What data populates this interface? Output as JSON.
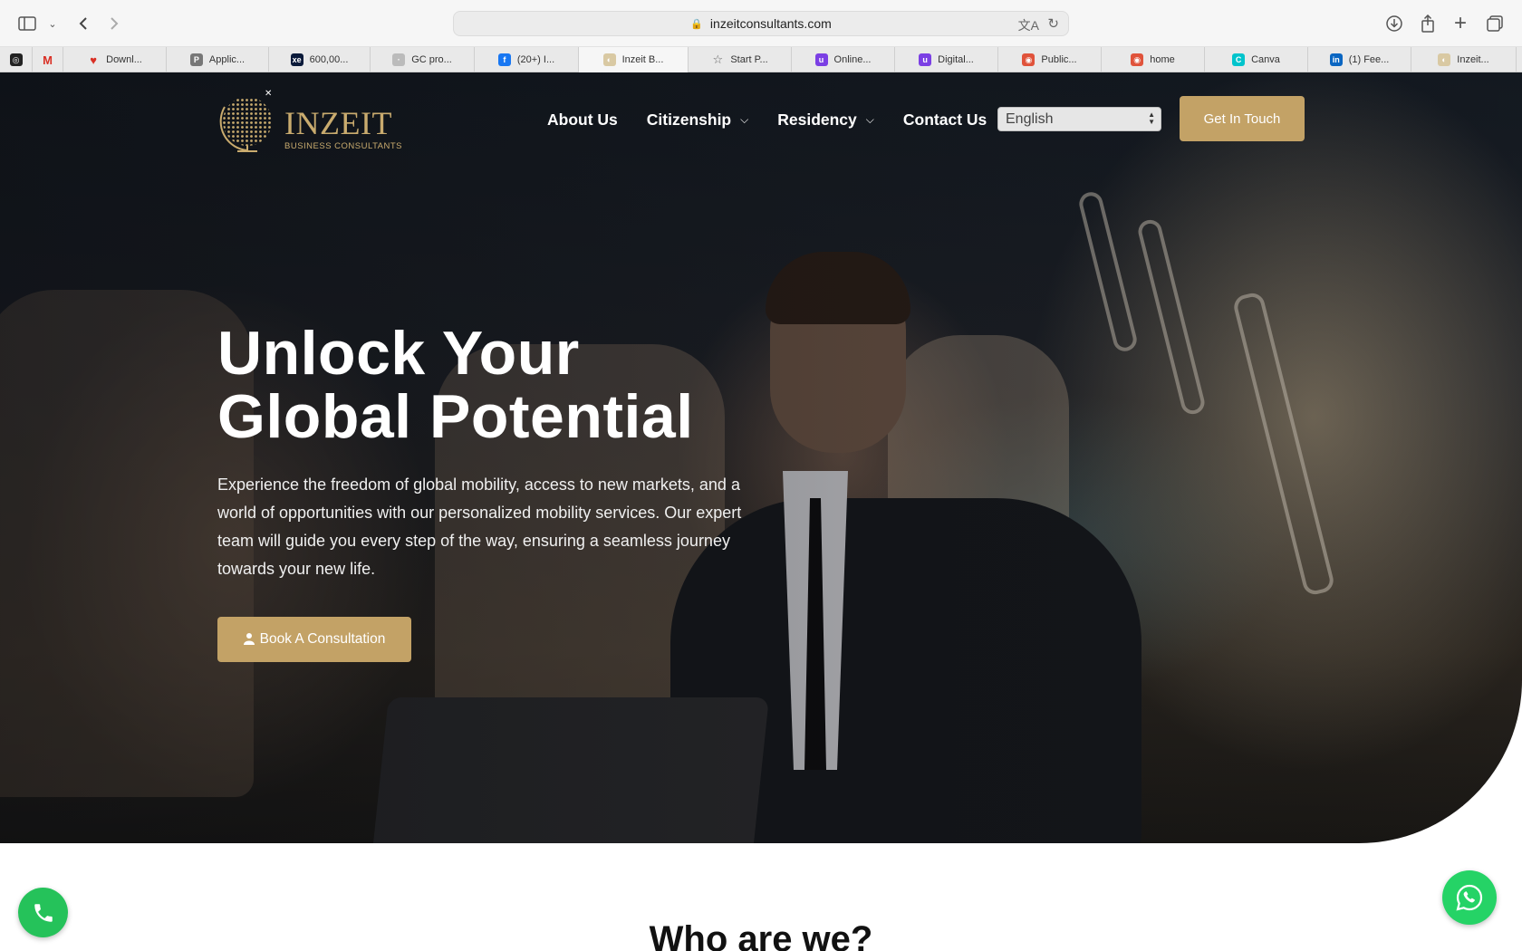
{
  "browser": {
    "url": "inzeitconsultants.com",
    "tabs": [
      {
        "label": "",
        "icon": "openai-icon",
        "color": "#222222"
      },
      {
        "label": "",
        "icon": "gmail-icon",
        "color": "#d93025"
      },
      {
        "label": "Downl...",
        "icon": "heart-icon",
        "color": "#d93025"
      },
      {
        "label": "Applic...",
        "icon": "p-icon",
        "color": "#777777"
      },
      {
        "label": "600,00...",
        "icon": "xe-icon",
        "color": "#0a1a3a"
      },
      {
        "label": "GC pro...",
        "icon": "page-icon",
        "color": "#bbbbbb"
      },
      {
        "label": "(20+) I...",
        "icon": "facebook-icon",
        "color": "#1877f2"
      },
      {
        "label": "Inzeit B...",
        "icon": "inzeit-icon",
        "color": "#d9c9a3"
      },
      {
        "label": "Start P...",
        "icon": "star-icon",
        "color": "#666666"
      },
      {
        "label": "Online...",
        "icon": "u-icon",
        "color": "#7b3fe4"
      },
      {
        "label": "Digital...",
        "icon": "u-icon",
        "color": "#7b3fe4"
      },
      {
        "label": "Public...",
        "icon": "target-icon",
        "color": "#e0533b"
      },
      {
        "label": "home",
        "icon": "target-icon",
        "color": "#e0533b"
      },
      {
        "label": "Canva",
        "icon": "canva-icon",
        "color": "#00c4cc"
      },
      {
        "label": "(1) Fee...",
        "icon": "linkedin-icon",
        "color": "#0a66c2"
      },
      {
        "label": "Inzeit...",
        "icon": "inzeit-icon",
        "color": "#d9c9a3"
      }
    ]
  },
  "site": {
    "logo": {
      "name": "INZEIT",
      "sub": "BUSINESS CONSULTANTS"
    },
    "nav": {
      "about": "About Us",
      "citizenship": "Citizenship",
      "residency": "Residency",
      "contact": "Contact Us"
    },
    "language": "English",
    "cta_top": "Get In Touch",
    "hero": {
      "line1": "Unlock Your",
      "line2": "Global Potential",
      "subtext": "Experience the freedom of global mobility, access to new markets, and a world of opportunities with our personalized mobility services. Our expert team will guide you every step of the way, ensuring a seamless journey towards your new life.",
      "cta": "Book A Consultation"
    },
    "section_title": "Who are we?",
    "colors": {
      "accent": "#c3a266",
      "whatsapp": "#25d366",
      "phone": "#25c25a"
    }
  }
}
